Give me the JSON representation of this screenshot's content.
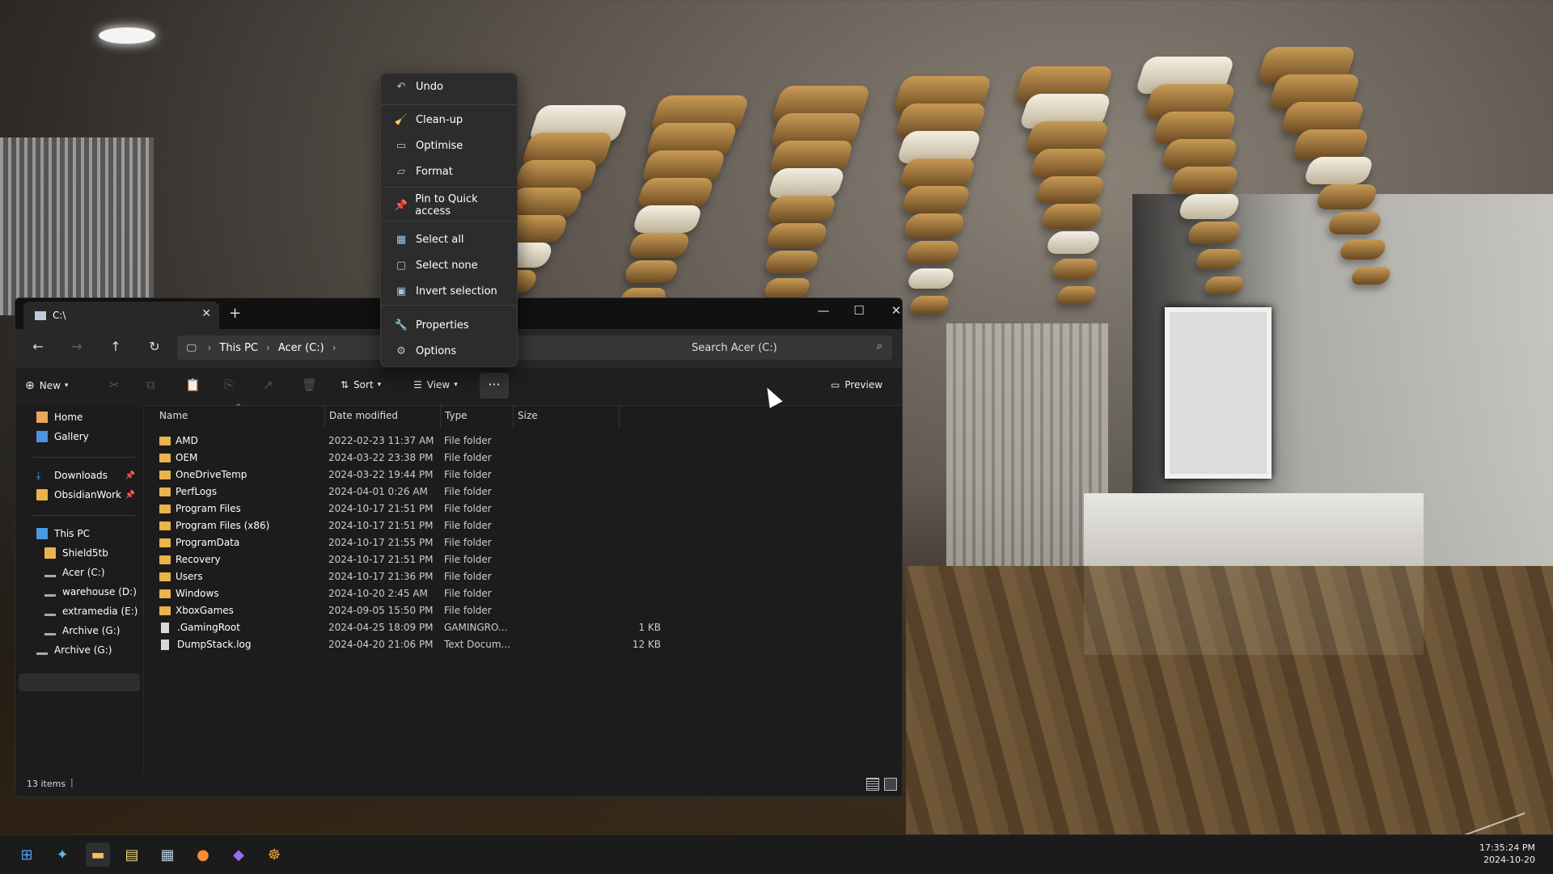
{
  "context_menu": {
    "items": [
      {
        "label": "Undo",
        "icon": "undo-icon"
      },
      {
        "label": "Clean-up",
        "icon": "broom-icon"
      },
      {
        "label": "Optimise",
        "icon": "optimise-icon"
      },
      {
        "label": "Format",
        "icon": "format-icon"
      },
      {
        "label": "Pin to Quick access",
        "icon": "pin-icon"
      },
      {
        "label": "Select all",
        "icon": "select-all-icon"
      },
      {
        "label": "Select none",
        "icon": "select-none-icon"
      },
      {
        "label": "Invert selection",
        "icon": "invert-selection-icon"
      },
      {
        "label": "Properties",
        "icon": "properties-icon"
      },
      {
        "label": "Options",
        "icon": "gear-icon"
      }
    ]
  },
  "explorer": {
    "tab_title": "C:\\",
    "breadcrumb": [
      "This PC",
      "Acer (C:)"
    ],
    "search_placeholder": "Search Acer (C:)",
    "toolbar": {
      "new": "New",
      "sort": "Sort",
      "view": "View",
      "preview": "Preview"
    },
    "sidebar": {
      "quick": [
        {
          "label": "Home"
        },
        {
          "label": "Gallery"
        }
      ],
      "pinned": [
        {
          "label": "Downloads"
        },
        {
          "label": "ObsidianWork"
        }
      ],
      "tree": [
        {
          "label": "This PC"
        },
        {
          "label": "Shield5tb"
        },
        {
          "label": "Acer (C:)"
        },
        {
          "label": "warehouse (D:)"
        },
        {
          "label": "extramedia (E:)"
        },
        {
          "label": "Archive (G:)"
        },
        {
          "label": "Archive (G:)"
        }
      ]
    },
    "columns": [
      "Name",
      "Date modified",
      "Type",
      "Size"
    ],
    "files": [
      {
        "name": "AMD",
        "date": "2022-02-23 11:37 AM",
        "type": "File folder",
        "size": "",
        "kind": "folder"
      },
      {
        "name": "OEM",
        "date": "2024-03-22 23:38 PM",
        "type": "File folder",
        "size": "",
        "kind": "folder"
      },
      {
        "name": "OneDriveTemp",
        "date": "2024-03-22 19:44 PM",
        "type": "File folder",
        "size": "",
        "kind": "folder"
      },
      {
        "name": "PerfLogs",
        "date": "2024-04-01 0:26 AM",
        "type": "File folder",
        "size": "",
        "kind": "folder"
      },
      {
        "name": "Program Files",
        "date": "2024-10-17 21:51 PM",
        "type": "File folder",
        "size": "",
        "kind": "folder"
      },
      {
        "name": "Program Files (x86)",
        "date": "2024-10-17 21:51 PM",
        "type": "File folder",
        "size": "",
        "kind": "folder"
      },
      {
        "name": "ProgramData",
        "date": "2024-10-17 21:55 PM",
        "type": "File folder",
        "size": "",
        "kind": "folder"
      },
      {
        "name": "Recovery",
        "date": "2024-10-17 21:51 PM",
        "type": "File folder",
        "size": "",
        "kind": "folder"
      },
      {
        "name": "Users",
        "date": "2024-10-17 21:36 PM",
        "type": "File folder",
        "size": "",
        "kind": "folder"
      },
      {
        "name": "Windows",
        "date": "2024-10-20 2:45 AM",
        "type": "File folder",
        "size": "",
        "kind": "folder"
      },
      {
        "name": "XboxGames",
        "date": "2024-09-05 15:50 PM",
        "type": "File folder",
        "size": "",
        "kind": "folder"
      },
      {
        "name": ".GamingRoot",
        "date": "2024-04-25 18:09 PM",
        "type": "GAMINGRO...",
        "size": "1 KB",
        "kind": "file"
      },
      {
        "name": "DumpStack.log",
        "date": "2024-04-20 21:06 PM",
        "type": "Text Docum...",
        "size": "12 KB",
        "kind": "file"
      }
    ],
    "status": "13 items"
  },
  "taskbar": {
    "icons": [
      "windows-start-icon",
      "copilot-icon",
      "file-explorer-icon",
      "notepad-icon",
      "calculator-icon",
      "firefox-icon",
      "obsidian-icon",
      "app-icon"
    ],
    "time": "17:35:24 PM",
    "date": "2024-10-20"
  },
  "colors": {
    "folder": "#e9b44c",
    "accent": "#9fc7ee",
    "window_bg": "#1c1c1c"
  }
}
